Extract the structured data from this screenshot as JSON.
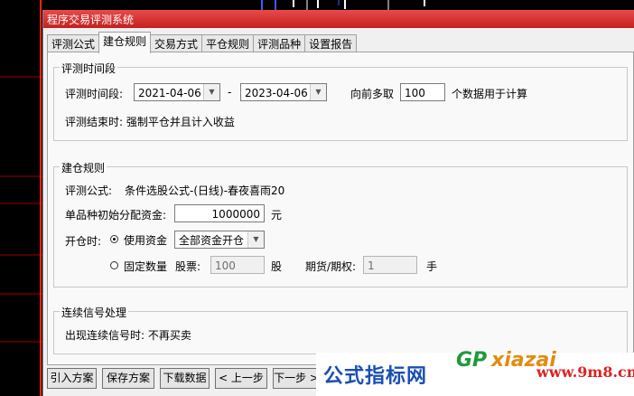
{
  "window": {
    "title": "程序交易评测系统"
  },
  "tabs": [
    "评测公式",
    "建仓规则",
    "交易方式",
    "平仓规则",
    "评测品种",
    "设置报告"
  ],
  "active_tab": 1,
  "eval_period": {
    "group_title": "评测时间段",
    "label": "评测时间段:",
    "start_date": "2021-04-06",
    "dash": "-",
    "end_date": "2023-04-06",
    "forward_label": "向前多取",
    "forward_value": "100",
    "forward_unit": "个数据用于计算",
    "end_label": "评测结束时: 强制平仓并且计入收益"
  },
  "open_rules": {
    "group_title": "建仓规则",
    "formula_label": "评测公式:",
    "formula_value": "条件选股公式-(日线)-春夜喜雨20",
    "capital_label": "单品种初始分配资金:",
    "capital_value": "1000000",
    "capital_unit": "元",
    "open_label": "开仓时:",
    "use_funds_label": "使用资金",
    "use_funds_option": "全部资金开仓",
    "fixed_qty_label": "固定数量",
    "stock_label": "股票:",
    "stock_value": "100",
    "stock_unit": "股",
    "futures_label": "期货/期权:",
    "futures_value": "1",
    "futures_unit": "手"
  },
  "continuous": {
    "group_title": "连续信号处理",
    "text": "出现连续信号时: 不再买卖"
  },
  "buttons": {
    "import": "引入方案",
    "save": "保存方案",
    "download": "下载数据",
    "prev": "< 上一步",
    "next": "下一步 >"
  },
  "watermark": {
    "text": "公式指标网",
    "logo_a": "GP",
    "logo_b": "xiazai",
    "url": "www.9m8.cn"
  },
  "colors": {
    "title_bar": "#d42a2a",
    "chart_red": "#ff2020",
    "chart_blue": "#3a5cff"
  }
}
